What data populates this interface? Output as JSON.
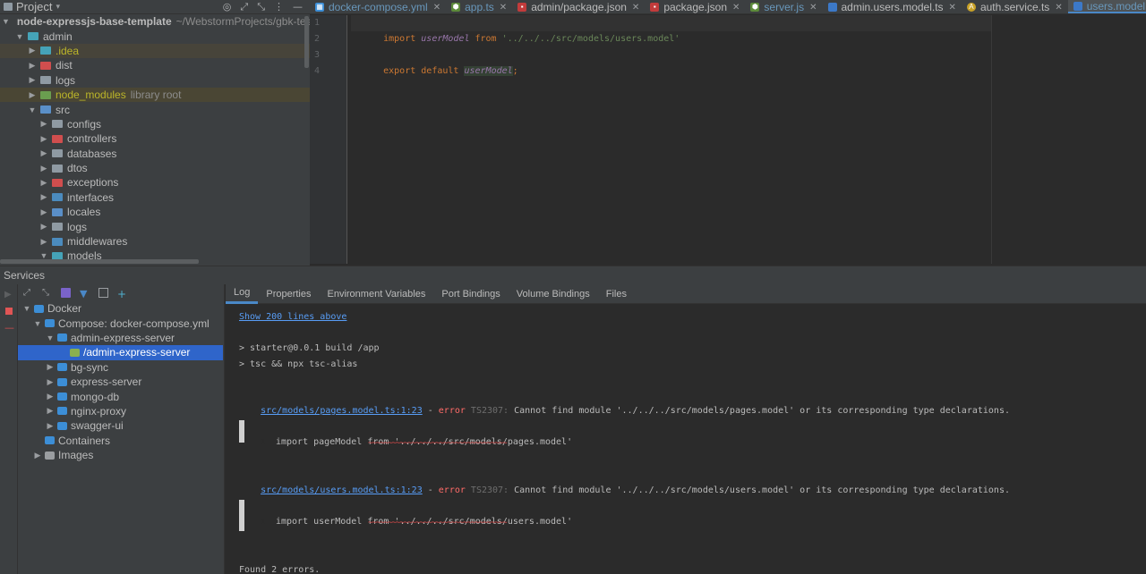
{
  "project_panel": {
    "title": "Project",
    "root": {
      "name": "node-expressjs-base-template",
      "path": "~/WebstormProjects/gbk-tes"
    },
    "items": [
      {
        "label": "admin",
        "depth": 1
      },
      {
        "label": ".idea",
        "depth": 2
      },
      {
        "label": "dist",
        "depth": 2
      },
      {
        "label": "logs",
        "depth": 2
      },
      {
        "label": "node_modules",
        "extra": "library root",
        "depth": 2
      },
      {
        "label": "src",
        "depth": 2
      },
      {
        "label": "configs",
        "depth": 3
      },
      {
        "label": "controllers",
        "depth": 3
      },
      {
        "label": "databases",
        "depth": 3
      },
      {
        "label": "dtos",
        "depth": 3
      },
      {
        "label": "exceptions",
        "depth": 3
      },
      {
        "label": "interfaces",
        "depth": 3
      },
      {
        "label": "locales",
        "depth": 3
      },
      {
        "label": "logs",
        "depth": 3
      },
      {
        "label": "middlewares",
        "depth": 3
      },
      {
        "label": "models",
        "depth": 3
      }
    ]
  },
  "editor_tabs": [
    {
      "label": "docker-compose.yml",
      "icon": "docker-icon"
    },
    {
      "label": "app.ts",
      "icon": "node-icon"
    },
    {
      "label": "admin/package.json",
      "icon": "npm-icon"
    },
    {
      "label": "package.json",
      "icon": "npm-icon"
    },
    {
      "label": "server.js",
      "icon": "node-icon"
    },
    {
      "label": "admin.users.model.ts",
      "icon": "ts-icon"
    },
    {
      "label": "auth.service.ts",
      "icon": "angular-service-icon"
    },
    {
      "label": "users.model.ts",
      "icon": "ts-icon",
      "active": true
    },
    {
      "label": "",
      "icon": "ts-icon"
    }
  ],
  "editor": {
    "line_numbers": [
      "1",
      "2",
      "3",
      "4"
    ],
    "lines": [
      {
        "kw1": "import",
        "ident": "userModel",
        "kw2": "from",
        "str": "'../../../src/models/users.model'"
      },
      {},
      {
        "kw1": "export",
        "kw2": "default",
        "ident": "userModel",
        "punct": ";"
      },
      {}
    ]
  },
  "services": {
    "title": "Services",
    "tree": [
      {
        "label": "Docker",
        "depth": 0
      },
      {
        "label": "Compose: docker-compose.yml",
        "depth": 1
      },
      {
        "label": "admin-express-server",
        "depth": 2
      },
      {
        "label": "/admin-express-server",
        "depth": 3,
        "selected": true
      },
      {
        "label": "bg-sync",
        "depth": 2
      },
      {
        "label": "express-server",
        "depth": 2
      },
      {
        "label": "mongo-db",
        "depth": 2
      },
      {
        "label": "nginx-proxy",
        "depth": 2
      },
      {
        "label": "swagger-ui",
        "depth": 2
      },
      {
        "label": "Containers",
        "depth": 1
      },
      {
        "label": "Images",
        "depth": 1
      }
    ],
    "tabs": [
      "Log",
      "Properties",
      "Environment Variables",
      "Port Bindings",
      "Volume Bindings",
      "Files"
    ],
    "active_tab": "Log",
    "log": {
      "show_more": "Show 200 lines above",
      "cmd1": "> starter@0.0.1 build /app",
      "cmd2": "> tsc && npx tsc-alias",
      "errors": [
        {
          "file": "src/models/pages.model.ts:1:23",
          "sep": " - ",
          "level": "error",
          "code": "TS2307:",
          "message": " Cannot find module '../../../src/models/pages.model' or its corresponding type declarations.",
          "line_no": "1",
          "source": "import pageModel from '../../../src/models/pages.model'",
          "squiggle": "~~~~~~~~~~~~~~~~~~~~~~~~~~~~~~~~~~~"
        },
        {
          "file": "src/models/users.model.ts:1:23",
          "sep": " - ",
          "level": "error",
          "code": "TS2307:",
          "message": " Cannot find module '../../../src/models/users.model' or its corresponding type declarations.",
          "line_no": "1",
          "source": "import userModel from '../../../src/models/users.model'",
          "squiggle": "~~~~~~~~~~~~~~~~~~~~~~~~~~~~~~~~~~~"
        }
      ],
      "summary": "Found 2 errors."
    }
  }
}
